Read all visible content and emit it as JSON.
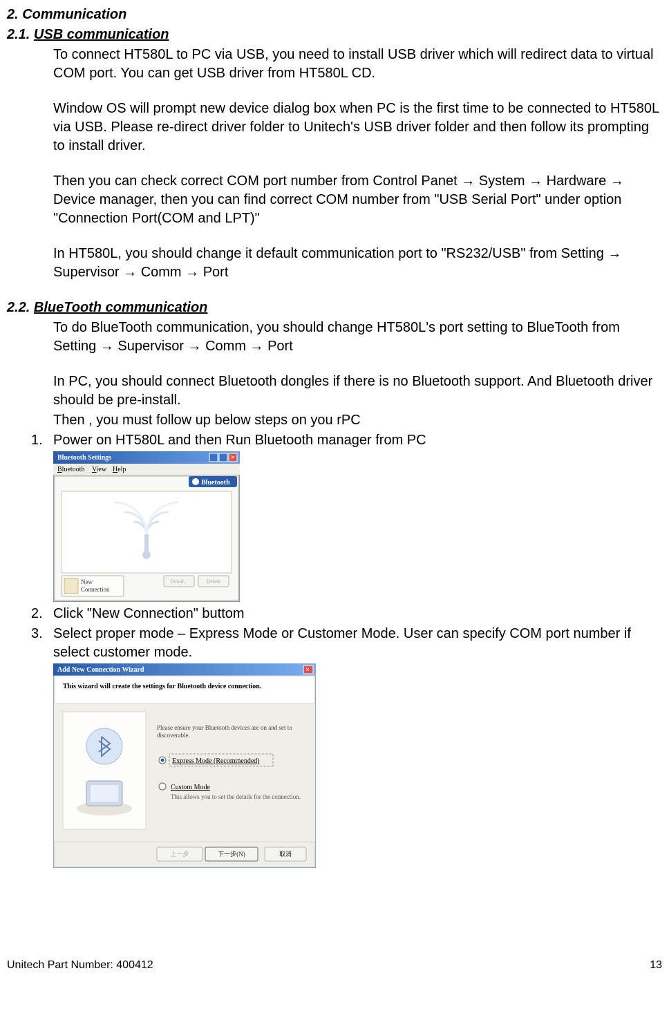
{
  "headings": {
    "h1": "2.  Communication",
    "h2_1_num": "2.1.  ",
    "h2_1_txt": "USB communication",
    "h2_2_num": "2.2.  ",
    "h2_2_txt": "BlueTooth communication"
  },
  "usb": {
    "p1": "To connect HT580L to PC via USB, you need to install USB driver which will redirect data to virtual COM port. You can get USB driver from HT580L CD.",
    "p2": "Window OS will prompt new device dialog box when PC is the first time to be connected to HT580L via USB. Please re-direct driver folder to Unitech's USB driver folder and then follow its prompting to install driver.",
    "p3": "Then you can check correct COM port number from Control Panet → System → Hardware → Device manager, then you can find correct COM number from \"USB Serial Port\" under option \"Connection Port(COM and LPT)\"",
    "p4": "In HT580L, you should change it default communication port to \"RS232/USB\" from Setting → Supervisor → Comm → Port"
  },
  "bt": {
    "p1": "To do BlueTooth communication, you should change HT580L's port setting to BlueTooth from Setting → Supervisor → Comm → Port",
    "p2": "In PC, you should connect Bluetooth dongles if there is no Bluetooth support. And Bluetooth driver should be pre-install.",
    "p3": "Then , you must follow up below steps on you rPC",
    "li1": "Power on HT580L and then Run Bluetooth manager from PC",
    "li2": "Click \"New Connection\" buttom",
    "li3": "Select proper mode – Express Mode or Customer Mode. User can specify COM port number if select customer mode."
  },
  "screenshot1": {
    "title": "Bluetooth Settings",
    "menu1": "Bluetooth",
    "menu2": "View",
    "menu3": "Help",
    "tab": "Bluetooth",
    "newconn": "New Connection",
    "btn_detail": "Detail...",
    "btn_delete": "Delete"
  },
  "screenshot2": {
    "title": "Add New Connection Wizard",
    "heading": "This wizard will create the settings for Bluetooth device connection.",
    "note": "Please ensure your Bluetooth devices are on and set to discoverable.",
    "opt1": "Express Mode (Recommended)",
    "opt2": "Custom Mode",
    "opt2sub": "This allows you to set the details for the connection.",
    "btn_back": "上一步",
    "btn_next": "下一步(N)",
    "btn_cancel": "取消"
  },
  "footer": {
    "left": "Unitech Part Number: 400412",
    "right": "13"
  }
}
